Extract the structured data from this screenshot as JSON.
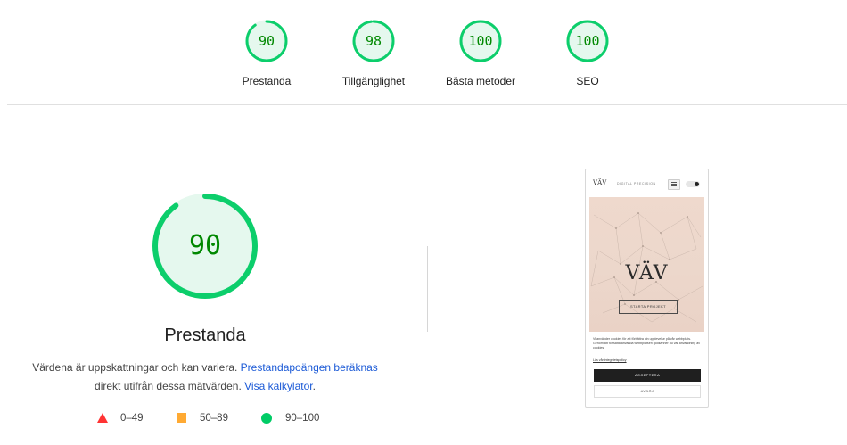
{
  "summary": [
    {
      "score": "90",
      "label": "Prestanda",
      "value": 90
    },
    {
      "score": "98",
      "label": "Tillgänglighet",
      "value": 98
    },
    {
      "score": "100",
      "label": "Bästa metoder",
      "value": 100
    },
    {
      "score": "100",
      "label": "SEO",
      "value": 100
    }
  ],
  "main": {
    "score": "90",
    "value": 90,
    "title": "Prestanda",
    "desc_text_1": "Värdena är uppskattningar och kan variera. ",
    "desc_link_1": "Prestandapoängen beräknas",
    "desc_text_2": "direkt utifrån dessa mätvärden. ",
    "desc_link_2": "Visa kalkylator",
    "desc_text_3": "."
  },
  "legend": [
    {
      "shape": "triangle-icon",
      "range": "0–49",
      "color": "#ff3333"
    },
    {
      "shape": "square-icon",
      "range": "50–89",
      "color": "#ffaa33"
    },
    {
      "shape": "circle-icon",
      "range": "90–100",
      "color": "#00cc66"
    }
  ],
  "colors": {
    "pass": "#0cce6b",
    "pass_fill": "#e5f8ee",
    "pass_text": "#008800",
    "link": "#1a59d6"
  },
  "screenshot": {
    "logo": "VÄV",
    "tagline": "DIGITAL PRECISION",
    "brand": "VÄV",
    "cta": "STARTA PROJEKT",
    "cookie_text": "Vi använder cookies för att förbättra din upplevelse på vår webbplats. Genom att fortsätta använda webbplatsen godkänner du vår användning av cookies.",
    "cookie_link": "Läs vår integritetspolicy",
    "accept": "ACCEPTERA",
    "decline": "AVBÖJ"
  }
}
